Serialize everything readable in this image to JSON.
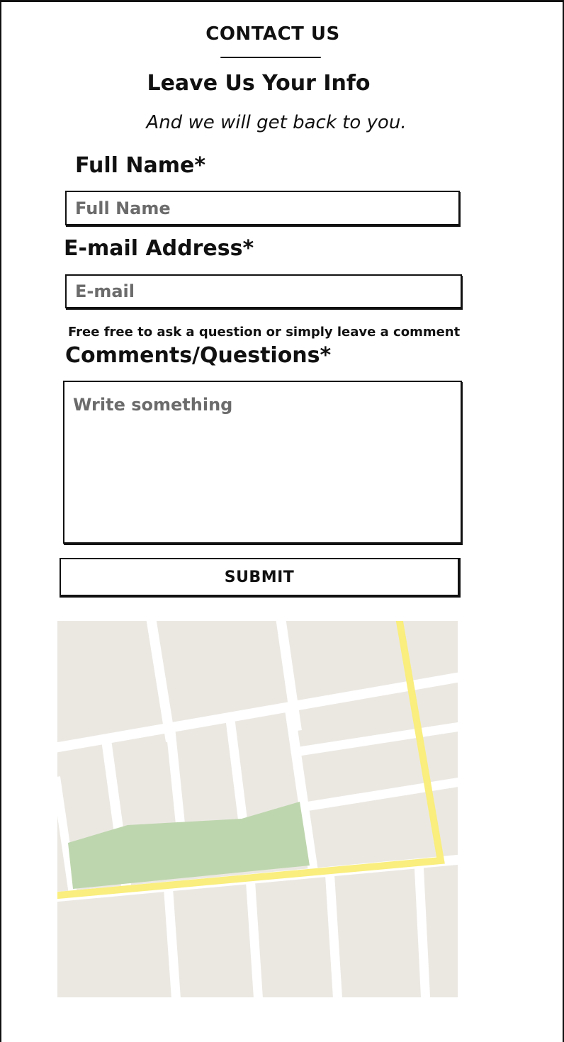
{
  "contact": {
    "section_title": "CONTACT US",
    "heading": "Leave Us Your Info",
    "subheading": "And we will get back to you."
  },
  "form": {
    "full_name": {
      "label": "Full Name*",
      "placeholder": "Full Name",
      "value": ""
    },
    "email": {
      "label": "E-mail Address*",
      "placeholder": "E-mail",
      "value": ""
    },
    "comments": {
      "hint": "Free free to ask a question or simply leave a comment",
      "label": "Comments/Questions*",
      "placeholder": "Write something",
      "value": ""
    },
    "submit_label": "SUBMIT"
  },
  "map": {
    "colors": {
      "block": "#ebe8e2",
      "street": "#ffffff",
      "highway": "#f9ee7e",
      "park": "#bed6ae"
    }
  }
}
